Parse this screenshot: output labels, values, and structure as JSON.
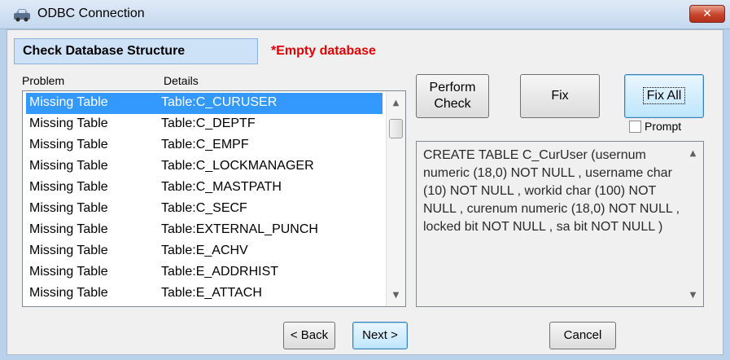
{
  "window": {
    "title": "ODBC Connection",
    "close_glyph": "✕",
    "app_icon": "odbc-car-icon"
  },
  "header": {
    "section_label": "Check Database Structure",
    "status": "*Empty database",
    "status_color": "#e00000"
  },
  "list": {
    "columns": [
      "Problem",
      "Details"
    ],
    "rows": [
      {
        "problem": "Missing Table",
        "details": "Table:C_CURUSER",
        "selected": true
      },
      {
        "problem": "Missing Table",
        "details": "Table:C_DEPTF"
      },
      {
        "problem": "Missing Table",
        "details": "Table:C_EMPF"
      },
      {
        "problem": "Missing Table",
        "details": "Table:C_LOCKMANAGER"
      },
      {
        "problem": "Missing Table",
        "details": "Table:C_MASTPATH"
      },
      {
        "problem": "Missing Table",
        "details": "Table:C_SECF"
      },
      {
        "problem": "Missing Table",
        "details": "Table:EXTERNAL_PUNCH"
      },
      {
        "problem": "Missing Table",
        "details": "Table:E_ACHV"
      },
      {
        "problem": "Missing Table",
        "details": "Table:E_ADDRHIST"
      },
      {
        "problem": "Missing Table",
        "details": "Table:E_ATTACH"
      }
    ]
  },
  "buttons": {
    "perform_check_line1": "Perform",
    "perform_check_line2": "Check",
    "fix": "Fix",
    "fix_all": "Fix All",
    "back": "< Back",
    "next": "Next >",
    "cancel": "Cancel"
  },
  "prompt": {
    "label": "Prompt",
    "checked": false
  },
  "sql_preview": "CREATE TABLE C_CurUser (usernum numeric (18,0) NOT NULL , username char (10) NOT NULL , workid char (100) NOT NULL , curenum numeric (18,0) NOT NULL , locked bit NOT NULL , sa bit NOT NULL )",
  "colors": {
    "selection": "#3399ff",
    "titlebar": "#c4d8ee",
    "header_box": "#cde1f7"
  }
}
